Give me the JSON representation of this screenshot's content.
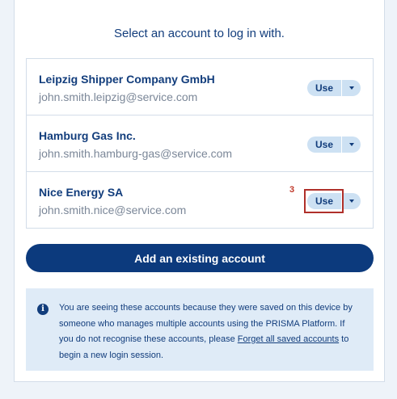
{
  "title": "Select an account to log in with.",
  "accounts": [
    {
      "name": "Leipzig Shipper Company GmbH",
      "email": "john.smith.leipzig@service.com",
      "use_label": "Use"
    },
    {
      "name": "Hamburg Gas Inc.",
      "email": "john.smith.hamburg-gas@service.com",
      "use_label": "Use"
    },
    {
      "name": "Nice Energy SA",
      "email": "john.smith.nice@service.com",
      "use_label": "Use"
    }
  ],
  "marker_label": "3",
  "add_button": "Add an existing account",
  "info": {
    "icon": "info-icon",
    "text_before": "You are seeing these accounts because they were saved on this device by someone who manages multiple accounts using the PRISMA Platform. If you do not recognise these accounts, please ",
    "link": "Forget all saved accounts",
    "text_after": " to begin a new login session."
  },
  "colors": {
    "brand": "#123d7c",
    "button": "#0c3a7d",
    "pill": "#cde1f3",
    "info_bg": "#dfebf7",
    "highlight": "#b0302a"
  }
}
